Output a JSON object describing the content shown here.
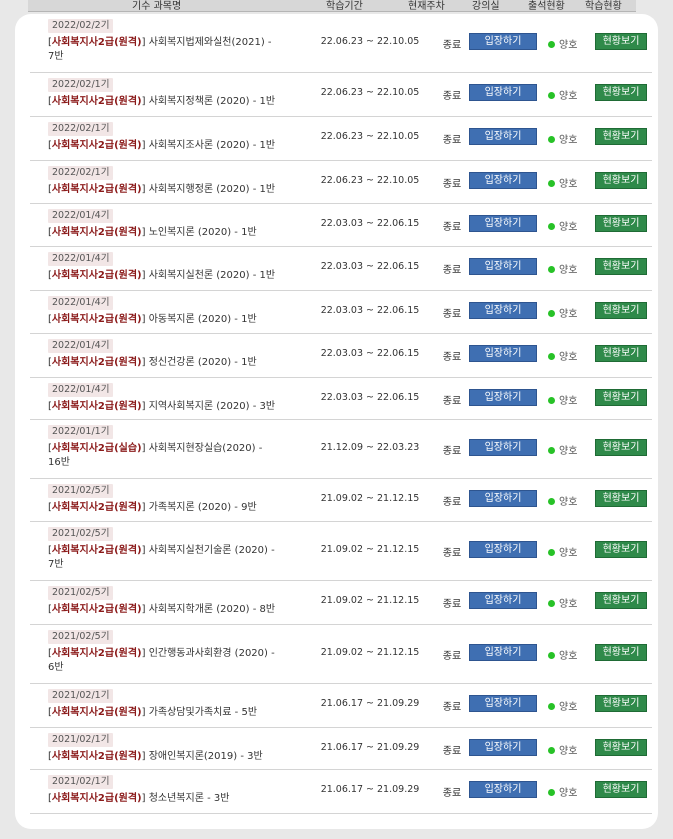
{
  "header": {
    "col_course": "기수 과목명",
    "col_period": "학습기간",
    "col_week": "현재주차",
    "col_room": "강의실",
    "col_attendance": "출석현황",
    "col_progress": "학습현황"
  },
  "rows": [
    {
      "term": "2022/02/2기",
      "program": "사회복지사2급(원격)",
      "subject": "사회복지법제와실천(2021) -",
      "section": "7반",
      "period": "22.06.23 ~ 22.10.05",
      "status": "종료",
      "enter_label": "입장하기",
      "attendance": "양호",
      "view_label": "현황보기"
    },
    {
      "term": "2022/02/1기",
      "program": "사회복지사2급(원격)",
      "subject": "사회복지정책론 (2020) - 1반",
      "section": "",
      "period": "22.06.23 ~ 22.10.05",
      "status": "종료",
      "enter_label": "입장하기",
      "attendance": "양호",
      "view_label": "현황보기"
    },
    {
      "term": "2022/02/1기",
      "program": "사회복지사2급(원격)",
      "subject": "사회복지조사론 (2020) - 1반",
      "section": "",
      "period": "22.06.23 ~ 22.10.05",
      "status": "종료",
      "enter_label": "입장하기",
      "attendance": "양호",
      "view_label": "현황보기"
    },
    {
      "term": "2022/02/1기",
      "program": "사회복지사2급(원격)",
      "subject": "사회복지행정론 (2020) - 1반",
      "section": "",
      "period": "22.06.23 ~ 22.10.05",
      "status": "종료",
      "enter_label": "입장하기",
      "attendance": "양호",
      "view_label": "현황보기"
    },
    {
      "term": "2022/01/4기",
      "program": "사회복지사2급(원격)",
      "subject": "노인복지론 (2020) - 1반",
      "section": "",
      "period": "22.03.03 ~ 22.06.15",
      "status": "종료",
      "enter_label": "입장하기",
      "attendance": "양호",
      "view_label": "현황보기"
    },
    {
      "term": "2022/01/4기",
      "program": "사회복지사2급(원격)",
      "subject": "사회복지실천론 (2020) - 1반",
      "section": "",
      "period": "22.03.03 ~ 22.06.15",
      "status": "종료",
      "enter_label": "입장하기",
      "attendance": "양호",
      "view_label": "현황보기"
    },
    {
      "term": "2022/01/4기",
      "program": "사회복지사2급(원격)",
      "subject": "아동복지론 (2020) - 1반",
      "section": "",
      "period": "22.03.03 ~ 22.06.15",
      "status": "종료",
      "enter_label": "입장하기",
      "attendance": "양호",
      "view_label": "현황보기"
    },
    {
      "term": "2022/01/4기",
      "program": "사회복지사2급(원격)",
      "subject": "정신건강론 (2020) - 1반",
      "section": "",
      "period": "22.03.03 ~ 22.06.15",
      "status": "종료",
      "enter_label": "입장하기",
      "attendance": "양호",
      "view_label": "현황보기"
    },
    {
      "term": "2022/01/4기",
      "program": "사회복지사2급(원격)",
      "subject": "지역사회복지론 (2020) - 3반",
      "section": "",
      "period": "22.03.03 ~ 22.06.15",
      "status": "종료",
      "enter_label": "입장하기",
      "attendance": "양호",
      "view_label": "현황보기"
    },
    {
      "term": "2022/01/1기",
      "program": "사회복지사2급(실습)",
      "subject": "사회복지현장실습(2020) -",
      "section": "16반",
      "period": "21.12.09 ~ 22.03.23",
      "status": "종료",
      "enter_label": "입장하기",
      "attendance": "양호",
      "view_label": "현황보기"
    },
    {
      "term": "2021/02/5기",
      "program": "사회복지사2급(원격)",
      "subject": "가족복지론 (2020) - 9반",
      "section": "",
      "period": "21.09.02 ~ 21.12.15",
      "status": "종료",
      "enter_label": "입장하기",
      "attendance": "양호",
      "view_label": "현황보기"
    },
    {
      "term": "2021/02/5기",
      "program": "사회복지사2급(원격)",
      "subject": "사회복지실천기술론 (2020) -",
      "section": "7반",
      "period": "21.09.02 ~ 21.12.15",
      "status": "종료",
      "enter_label": "입장하기",
      "attendance": "양호",
      "view_label": "현황보기"
    },
    {
      "term": "2021/02/5기",
      "program": "사회복지사2급(원격)",
      "subject": "사회복지학개론 (2020) - 8반",
      "section": "",
      "period": "21.09.02 ~ 21.12.15",
      "status": "종료",
      "enter_label": "입장하기",
      "attendance": "양호",
      "view_label": "현황보기"
    },
    {
      "term": "2021/02/5기",
      "program": "사회복지사2급(원격)",
      "subject": "인간행동과사회환경 (2020) -",
      "section": "6반",
      "period": "21.09.02 ~ 21.12.15",
      "status": "종료",
      "enter_label": "입장하기",
      "attendance": "양호",
      "view_label": "현황보기"
    },
    {
      "term": "2021/02/1기",
      "program": "사회복지사2급(원격)",
      "subject": "가족상담및가족치료 - 5반",
      "section": "",
      "period": "21.06.17 ~ 21.09.29",
      "status": "종료",
      "enter_label": "입장하기",
      "attendance": "양호",
      "view_label": "현황보기"
    },
    {
      "term": "2021/02/1기",
      "program": "사회복지사2급(원격)",
      "subject": "장애인복지론(2019) - 3반",
      "section": "",
      "period": "21.06.17 ~ 21.09.29",
      "status": "종료",
      "enter_label": "입장하기",
      "attendance": "양호",
      "view_label": "현황보기"
    },
    {
      "term": "2021/02/1기",
      "program": "사회복지사2급(원격)",
      "subject": "청소년복지론 - 3반",
      "section": "",
      "period": "21.06.17 ~ 21.09.29",
      "status": "종료",
      "enter_label": "입장하기",
      "attendance": "양호",
      "view_label": "현황보기"
    }
  ]
}
